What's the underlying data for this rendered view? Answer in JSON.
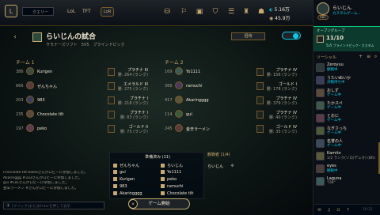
{
  "topbar": {
    "search_placeholder": "クエリー",
    "nav": [
      "LoL",
      "TFT",
      "LoR"
    ],
    "currency_be": "5.16万",
    "currency_rp": "45.9万",
    "profile_name": "らいじん",
    "profile_status": "カスタムゲーム...",
    "profile_level": "487"
  },
  "lobby": {
    "title": "らいじんの試合",
    "subtitle": "サモナーズリフト　5V5　ブラインドピック",
    "invite_label": "招待",
    "team1_label": "チーム 1",
    "team2_label": "チーム 2",
    "team1": [
      {
        "level": "386",
        "name": "Kurigen",
        "rank": "プラチナ III",
        "stats": "勝: 264 (ランク)"
      },
      {
        "level": "666",
        "name": "ぜんちゃん",
        "rank": "エメラルド III",
        "stats": "勝: 275 (ランク)"
      },
      {
        "level": "203",
        "name": "983",
        "rank": "プラチナ I",
        "stats": "勝: 218 (ランク)"
      },
      {
        "level": "235",
        "name": "Chocolate tilt",
        "rank": "プラチナ I",
        "stats": "勝: 83 (ランク)"
      },
      {
        "level": "197",
        "name": "peko",
        "rank": "ゴールド II",
        "stats": "勝: 75 (ランク)"
      }
    ],
    "team2": [
      {
        "level": "169",
        "name": "Yo1111",
        "rank": "プラチナ IV",
        "stats": "勝: 156 (ランク)"
      },
      {
        "level": "366",
        "name": "ramuchi",
        "rank": "ゴールド I",
        "stats": "勝: 178 (ランク)"
      },
      {
        "level": "417",
        "name": "Akaringggg",
        "rank": "プラチナ IV",
        "stats": "勝: 379 (ランク)"
      },
      {
        "level": "114",
        "name": "gui",
        "rank": "プラチナ IV",
        "stats": "勝: 40 (ランク)"
      },
      {
        "level": "245",
        "name": "金辛ラーメン",
        "rank": "ゴールド IV",
        "stats": "勝: 35 (ランク)"
      }
    ],
    "ready_title": "準備済み (11)",
    "ready_left": [
      "ぜんちゃん",
      "gui",
      "Kurigen",
      "983",
      "Akaringggg"
    ],
    "ready_right": [
      "らいじん",
      "Yo1111",
      "peko",
      "ramuchi",
      "Chocolate tilt"
    ],
    "spectators_title": "観戦者 (1/4)",
    "spectator": "らいじん",
    "start_label": "ゲーム開始"
  },
  "chat": {
    "lines": [
      "Chocolate tilt Kaleaさんがロビーに参加しました。",
      "Akaringgg #333さんがロビーに参加しました。",
      "gui #LoLさんがロビーに参加しました。",
      "金辛ラーメン #さんがロビーに参加しました。"
    ],
    "input_placeholder": "[クリック]またはEnterを押して表示"
  },
  "social": {
    "open_group_label": "オープングループ",
    "open_group_count": "11/10",
    "open_group_sub": "5v5 ブラインドピック・カスタム",
    "social_label": "ソーシャル",
    "friends": [
      {
        "name": "Zeroyuu",
        "status": "観戦中"
      },
      {
        "name": "うたいぬいか",
        "status": "対戦待ち中"
      },
      {
        "name": "おしず",
        "status": "ゲーム中"
      },
      {
        "name": "たかスペ",
        "status": "ゲーム中"
      },
      {
        "name": "とおに",
        "status": "ゲーム中"
      },
      {
        "name": "なぎさっち",
        "status": "ゲーム中"
      },
      {
        "name": "名誉の人",
        "status": "ゲーム中"
      },
      {
        "name": "Kamito",
        "status": "1/2 ランク(ソロ/デュオ) (BR)"
      },
      {
        "name": "eyes",
        "status": "観戦中"
      },
      {
        "name": "Laguna",
        "status": "\"DB\""
      }
    ],
    "footer_time": "16:21"
  },
  "colors": {
    "gold": "#c8aa6e",
    "cyan": "#0acbe6",
    "bg": "#010a13",
    "panel": "#0a1015"
  }
}
